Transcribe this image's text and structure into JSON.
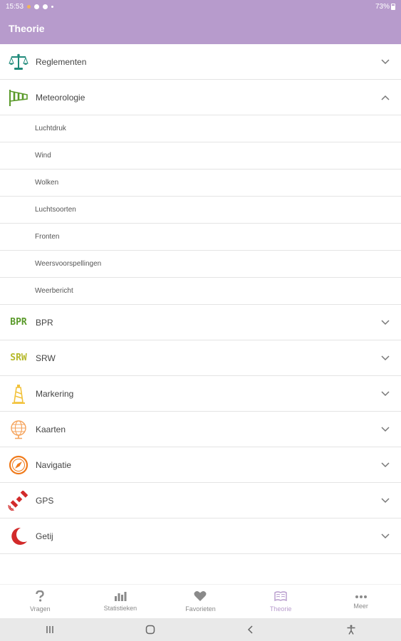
{
  "status_bar": {
    "time": "15:53",
    "battery": "73%"
  },
  "app_bar": {
    "title": "Theorie"
  },
  "sections": [
    {
      "label": "Reglementen",
      "icon": "scales-icon",
      "expanded": false
    },
    {
      "label": "Meteorologie",
      "icon": "windsock-icon",
      "expanded": true,
      "items": [
        "Luchtdruk",
        "Wind",
        "Wolken",
        "Luchtsoorten",
        "Fronten",
        "Weersvoorspellingen",
        "Weerbericht"
      ]
    },
    {
      "label": "BPR",
      "icon_text": "BPR",
      "icon": "bpr-icon",
      "expanded": false
    },
    {
      "label": "SRW",
      "icon_text": "SRW",
      "icon": "srw-icon",
      "expanded": false
    },
    {
      "label": "Markering",
      "icon": "lighthouse-icon",
      "expanded": false
    },
    {
      "label": "Kaarten",
      "icon": "globe-icon",
      "expanded": false
    },
    {
      "label": "Navigatie",
      "icon": "compass-icon",
      "expanded": false
    },
    {
      "label": "GPS",
      "icon": "satellite-icon",
      "expanded": false
    },
    {
      "label": "Getij",
      "icon": "moon-icon",
      "expanded": false
    }
  ],
  "bottom_nav": [
    {
      "label": "Vragen",
      "icon": "question-icon",
      "active": false
    },
    {
      "label": "Statistieken",
      "icon": "bar-chart-icon",
      "active": false
    },
    {
      "label": "Favorieten",
      "icon": "heart-icon",
      "active": false
    },
    {
      "label": "Theorie",
      "icon": "book-icon",
      "active": true
    },
    {
      "label": "Meer",
      "icon": "more-icon",
      "active": false
    }
  ],
  "colors": {
    "accent": "#b79bcc",
    "divider": "#e4e4e4",
    "teal": "#1f8a7a",
    "green": "#5a9a2a",
    "yellow_green": "#b5b82a",
    "orange": "#f07a1a",
    "red": "#d22a2a",
    "yellow": "#f2c23a"
  }
}
